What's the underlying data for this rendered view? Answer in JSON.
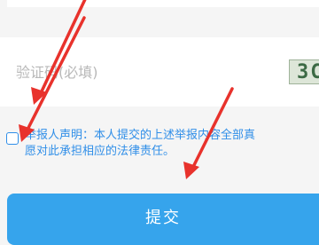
{
  "captcha": {
    "placeholder": "验证码(必填)",
    "image_text": "3C"
  },
  "statement": {
    "text": "举报人声明：本人提交的上述举报内容全部真\n愿对此承担相应的法律责任。"
  },
  "submit": {
    "label": "提交"
  },
  "annotation": {
    "arrow_color": "#e8322c"
  }
}
